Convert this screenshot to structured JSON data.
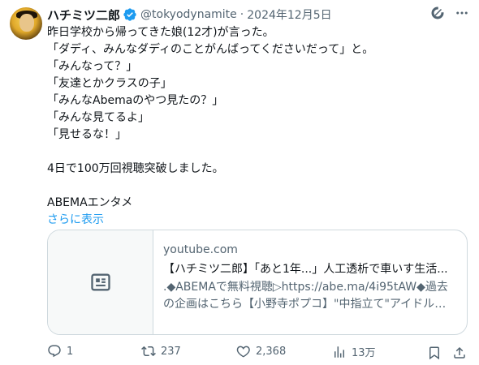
{
  "header": {
    "name": "ハチミツ二郎",
    "handle": "@tokyodynamite",
    "separator": "·",
    "date": "2024年12月5日"
  },
  "tweet": {
    "lines": [
      "昨日学校から帰ってきた娘(12才)が言った。",
      "「ダディ、みんなダディのことがんばってくださいだって」と。",
      "「みんなって？」",
      "「友達とかクラスの子」",
      "「みんなAbemaのやつ見たの？」",
      "「みんな見てるよ」",
      "「見せるな！」",
      "",
      "4日で100万回視聴突破しました。",
      "",
      "ABEMAエンタメ"
    ],
    "show_more": "さらに表示"
  },
  "card": {
    "domain": "youtube.com",
    "title": "【ハチミツ二郎】「あと1年...」人工透析で車いす生活...",
    "desc_line1": ".◆ABEMAで無料視聴▷https://abe.ma/4i95tAW◆過去",
    "desc_line2": "の企画はこちら【小野寺ポプコ】\"中指立て\"アイドルを..."
  },
  "actions": {
    "reply_count": "1",
    "retweet_count": "237",
    "like_count": "2,368",
    "view_count": "13万"
  },
  "colors": {
    "link": "#1d9bf0",
    "muted": "#536471",
    "verified": "#1d9bf0",
    "border": "#cfd9de"
  }
}
